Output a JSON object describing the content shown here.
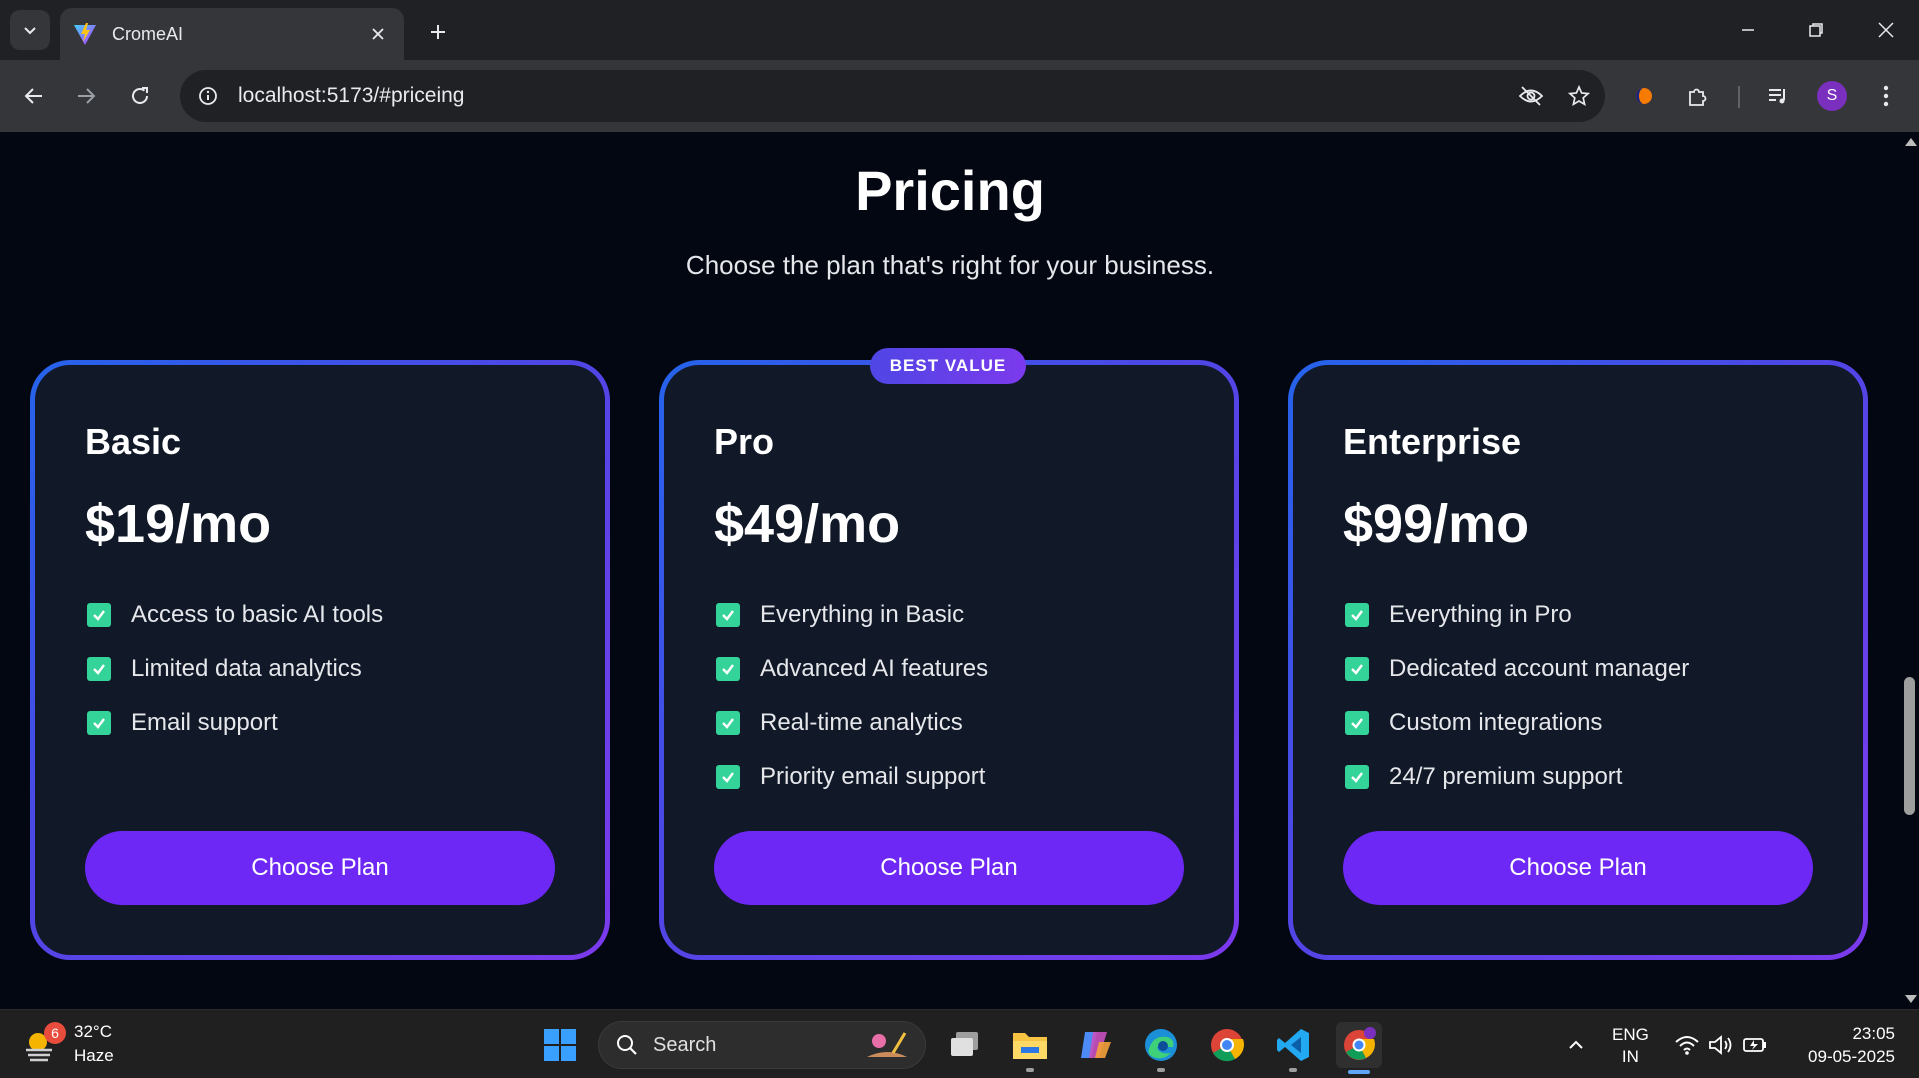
{
  "browser": {
    "tab_title": "CromeAI",
    "url": "localhost:5173/#priceing",
    "profile_initial": "S"
  },
  "page": {
    "title": "Pricing",
    "subtitle": "Choose the plan that's right for your business.",
    "badge": "BEST VALUE",
    "plans": [
      {
        "name": "Basic",
        "price": "$19/mo",
        "features": [
          "Access to basic AI tools",
          "Limited data analytics",
          "Email support"
        ],
        "button": "Choose Plan"
      },
      {
        "name": "Pro",
        "price": "$49/mo",
        "features": [
          "Everything in Basic",
          "Advanced AI features",
          "Real-time analytics",
          "Priority email support"
        ],
        "button": "Choose Plan"
      },
      {
        "name": "Enterprise",
        "price": "$99/mo",
        "features": [
          "Everything in Pro",
          "Dedicated account manager",
          "Custom integrations",
          "24/7 premium support"
        ],
        "button": "Choose Plan"
      }
    ]
  },
  "taskbar": {
    "weather_badge": "6",
    "temperature": "32°C",
    "condition": "Haze",
    "search_label": "Search",
    "language": "ENG",
    "region": "IN",
    "time": "23:05",
    "date": "09-05-2025"
  },
  "colors": {
    "accent": "#6d28f5",
    "check": "#34d399",
    "card_bg": "#111827",
    "page_bg": "#030712"
  }
}
